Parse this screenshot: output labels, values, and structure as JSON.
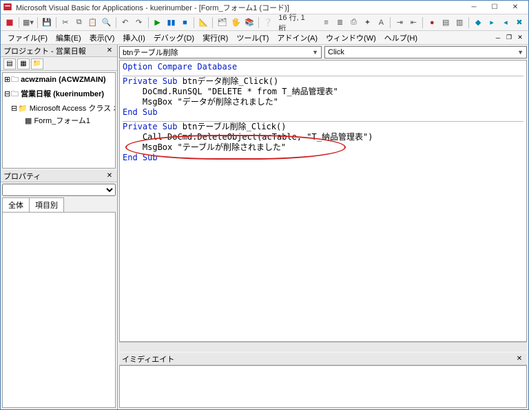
{
  "window": {
    "title": "Microsoft Visual Basic for Applications - kuerinumber - [Form_フォーム1 (コード)]"
  },
  "status": {
    "line_col": "16 行, 1 桁"
  },
  "menu": {
    "file": "ファイル(F)",
    "edit": "編集(E)",
    "view": "表示(V)",
    "insert": "挿入(I)",
    "debug": "デバッグ(D)",
    "run": "実行(R)",
    "tools": "ツール(T)",
    "addins": "アドイン(A)",
    "window": "ウィンドウ(W)",
    "help": "ヘルプ(H)"
  },
  "project_panel": {
    "title": "プロジェクト - 営業日報",
    "tree": {
      "root1": "acwzmain (ACWZMAIN)",
      "root2": "営業日報 (kuerinumber)",
      "folder": "Microsoft Access クラス オブ",
      "item": "Form_フォーム1"
    }
  },
  "properties_panel": {
    "title": "プロパティ",
    "tab1": "全体",
    "tab2": "項目別"
  },
  "code_header": {
    "object": "btnテーブル削除",
    "proc": "Click"
  },
  "code": {
    "l1": "Option Compare Database",
    "l2a": "Private Sub",
    "l2b": " btnデータ削除_Click()",
    "l3": "    DoCmd.RunSQL \"DELETE * from T_納品管理表\"",
    "l4": "    MsgBox \"データが削除されました\"",
    "l5": "End Sub",
    "l6a": "Private Sub",
    "l6b": " btnテーブル削除_Click()",
    "l7": "    Call DoCmd.DeleteObject(acTable, \"T_納品管理表\")",
    "l8": "    MsgBox \"テーブルが削除されました\"",
    "l9": "End Sub"
  },
  "immediate": {
    "title": "イミディエイト"
  }
}
